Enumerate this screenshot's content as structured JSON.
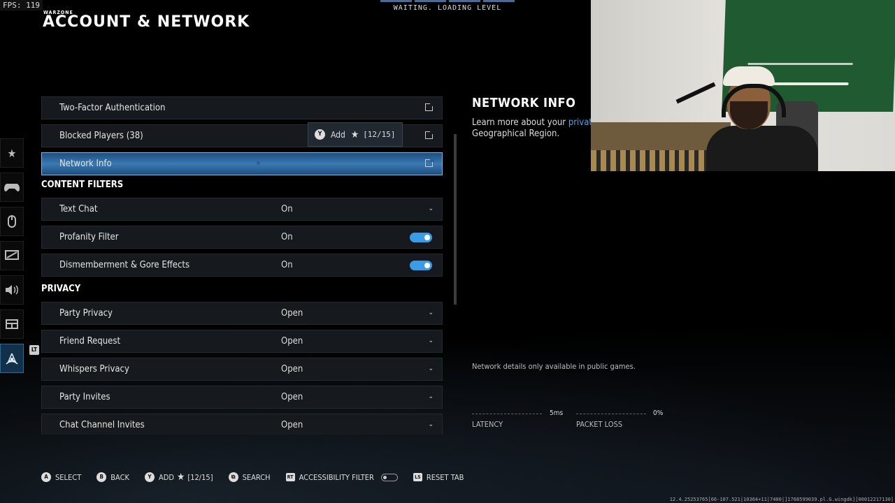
{
  "fps": "FPS: 119",
  "header": {
    "logo": "WARZONE",
    "title": "ACCOUNT & NETWORK"
  },
  "loading": {
    "text": "WAITING. LOADING LEVEL"
  },
  "account_rows": [
    {
      "label": "Two-Factor Authentication"
    },
    {
      "label": "Blocked Players (38)"
    },
    {
      "label": "Network Info"
    }
  ],
  "tooltip": {
    "button": "Y",
    "label": "Add",
    "count": "[12/15]"
  },
  "content_filters": {
    "heading": "CONTENT FILTERS",
    "rows": [
      {
        "label": "Text Chat",
        "value": "On",
        "control": "dropdown"
      },
      {
        "label": "Profanity Filter",
        "value": "On",
        "control": "toggle"
      },
      {
        "label": "Dismemberment & Gore Effects",
        "value": "On",
        "control": "toggle"
      }
    ]
  },
  "privacy": {
    "heading": "PRIVACY",
    "rows": [
      {
        "label": "Party Privacy",
        "value": "Open"
      },
      {
        "label": "Friend Request",
        "value": "Open"
      },
      {
        "label": "Whispers Privacy",
        "value": "Open"
      },
      {
        "label": "Party Invites",
        "value": "Open"
      },
      {
        "label": "Chat Channel Invites",
        "value": "Open"
      }
    ]
  },
  "info_panel": {
    "title": "NETWORK INFO",
    "desc_prefix": "Learn more about your",
    "desc_link": "private s",
    "desc_line2": "Geographical Region.",
    "note": "Network details only available in public games.",
    "latency_value": "5ms",
    "latency_label": "LATENCY",
    "packet_value": "0%",
    "packet_label": "PACKET LOSS"
  },
  "footer": {
    "select": {
      "glyph": "A",
      "label": "SELECT"
    },
    "back": {
      "glyph": "B",
      "label": "BACK"
    },
    "add": {
      "glyph": "Y",
      "label": "ADD",
      "count": "[12/15]"
    },
    "search": {
      "glyph": "⧉",
      "label": "SEARCH"
    },
    "accessibility": {
      "glyph": "RT",
      "label": "ACCESSIBILITY FILTER"
    },
    "reset": {
      "glyph": "LS",
      "label": "RESET TAB"
    }
  },
  "build": "12.4.25253765[66-107.521|10364+11|7400|]1768599039.pl.G.wingdk][00012217130]",
  "icons": [
    "star-icon",
    "controller-icon",
    "mouse-icon",
    "graphics-icon",
    "audio-icon",
    "interface-icon",
    "network-icon"
  ],
  "colors": {
    "accent": "#3a9be6",
    "selected_row": "#2a629a"
  }
}
